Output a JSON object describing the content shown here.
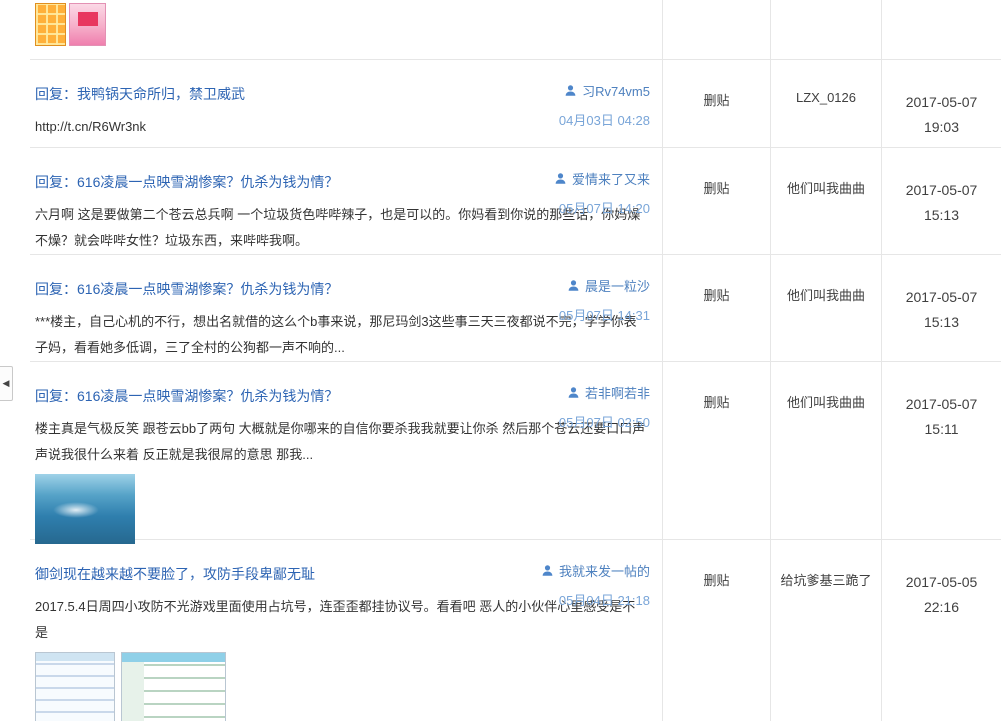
{
  "page": {
    "collapse_arrow": "◀"
  },
  "colors": {
    "title_link": "#2d64b3",
    "author_link": "#4e81bf",
    "post_time_text": "#79a5d8",
    "body_text": "#333333",
    "table_border": "#e6e6e6"
  },
  "partial_row": {
    "stickers": [
      {
        "name": "emoji-grid-sticker"
      },
      {
        "name": "pink-flower-sticker"
      }
    ]
  },
  "rows": [
    {
      "title": "回复：我鸭锅天命所归，禁卫威武",
      "content": "http://t.cn/R6Wr3nk",
      "author": "习Rv74vm5",
      "post_time": "04月03日 04:28",
      "delete_label": "删贴",
      "operator": "LZX_0126",
      "deleted_date": "2017-05-07",
      "deleted_time": "19:03"
    },
    {
      "title": "回复：616凌晨一点映雪湖惨案？仇杀为钱为情？",
      "content": "六月啊 这是要做第二个苍云总兵啊 一个垃圾货色哔哔辣子，也是可以的。你妈看到你说的那些话，你妈燥不燥？就会哔哔女性？垃圾东西，来哔哔我啊。",
      "author": "爱情来了又来",
      "post_time": "05月07日 14:20",
      "delete_label": "删贴",
      "operator": "他们叫我曲曲",
      "deleted_date": "2017-05-07",
      "deleted_time": "15:13"
    },
    {
      "title": "回复：616凌晨一点映雪湖惨案？仇杀为钱为情？",
      "content": "***楼主，自己心机的不行，想出名就借的这么个b事来说，那尼玛剑3这些事三天三夜都说不完，学学你表子妈，看看她多低调，三了全村的公狗都一声不响的...",
      "author": "晨是一粒沙",
      "post_time": "05月07日 14:31",
      "delete_label": "删贴",
      "operator": "他们叫我曲曲",
      "deleted_date": "2017-05-07",
      "deleted_time": "15:13"
    },
    {
      "title": "回复：616凌晨一点映雪湖惨案？仇杀为钱为情？",
      "content": "楼主真是气极反笑 跟苍云bb了两句 大概就是你哪来的自信你要杀我我就要让你杀 然后那个苍云还要口口声声说我很什么来着 反正就是我很屌的意思 那我...",
      "author": "若非啊若非",
      "post_time": "05月07日 02:50",
      "delete_label": "删贴",
      "operator": "他们叫我曲曲",
      "deleted_date": "2017-05-07",
      "deleted_time": "15:11",
      "images": [
        {
          "name": "game-screenshot-thumbnail"
        }
      ]
    },
    {
      "title": "御剑现在越来越不要脸了，攻防手段卑鄙无耻",
      "content": "2017.5.4日周四小攻防不光游戏里面使用占坑号，连歪歪都挂协议号。看看吧 恶人的小伙伴心里感受是不是",
      "author": "我就来发一帖的",
      "post_time": "05月04日 21:18",
      "delete_label": "删贴",
      "operator": "给坑爹基三跪了",
      "deleted_date": "2017-05-05",
      "deleted_time": "22:16",
      "images": [
        {
          "name": "chat-screenshot-thumbnail-1"
        },
        {
          "name": "chat-screenshot-thumbnail-2"
        }
      ]
    }
  ]
}
